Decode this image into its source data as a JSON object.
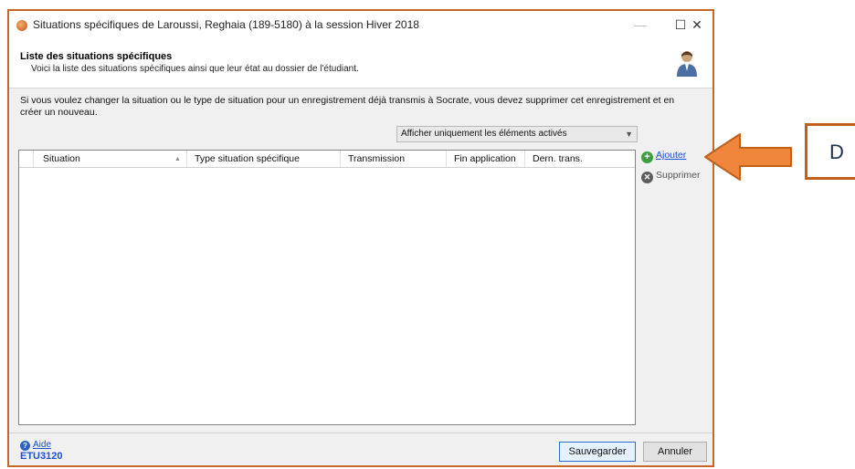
{
  "window": {
    "title": "Situations spécifiques de Laroussi, Reghaia (189-5180) à la session Hiver 2018",
    "controls": {
      "minimize": "—",
      "maximize": "☐",
      "close": "✕"
    }
  },
  "header": {
    "title": "Liste des situations spécifiques",
    "subtitle": "Voici la liste des situations spécifiques ainsi que leur état au dossier de l'étudiant."
  },
  "info_text": "Si vous voulez changer la situation ou le type de situation pour un enregistrement déjà transmis à Socrate, vous devez supprimer cet enregistrement et en créer un nouveau.",
  "filter": {
    "selected": "Afficher uniquement les éléments activés"
  },
  "grid": {
    "columns": [
      "Situation",
      "Type situation spécifique",
      "Transmission",
      "Fin application",
      "Dern. trans."
    ],
    "sort_column": "Situation",
    "rows": []
  },
  "actions": {
    "add": "Ajouter",
    "delete": "Supprimer"
  },
  "footer": {
    "help": "Aide",
    "screen_code": "ETU3120",
    "save": "Sauvegarder",
    "cancel": "Annuler"
  },
  "annotation": {
    "label": "D"
  },
  "colors": {
    "accent_border": "#c7662a",
    "arrow": "#f0863c",
    "link": "#1a4fd6"
  },
  "icons": {
    "app": "sunflower-icon",
    "user": "user-icon",
    "add": "add-circle-icon",
    "delete": "delete-circle-icon",
    "help": "help-icon"
  }
}
